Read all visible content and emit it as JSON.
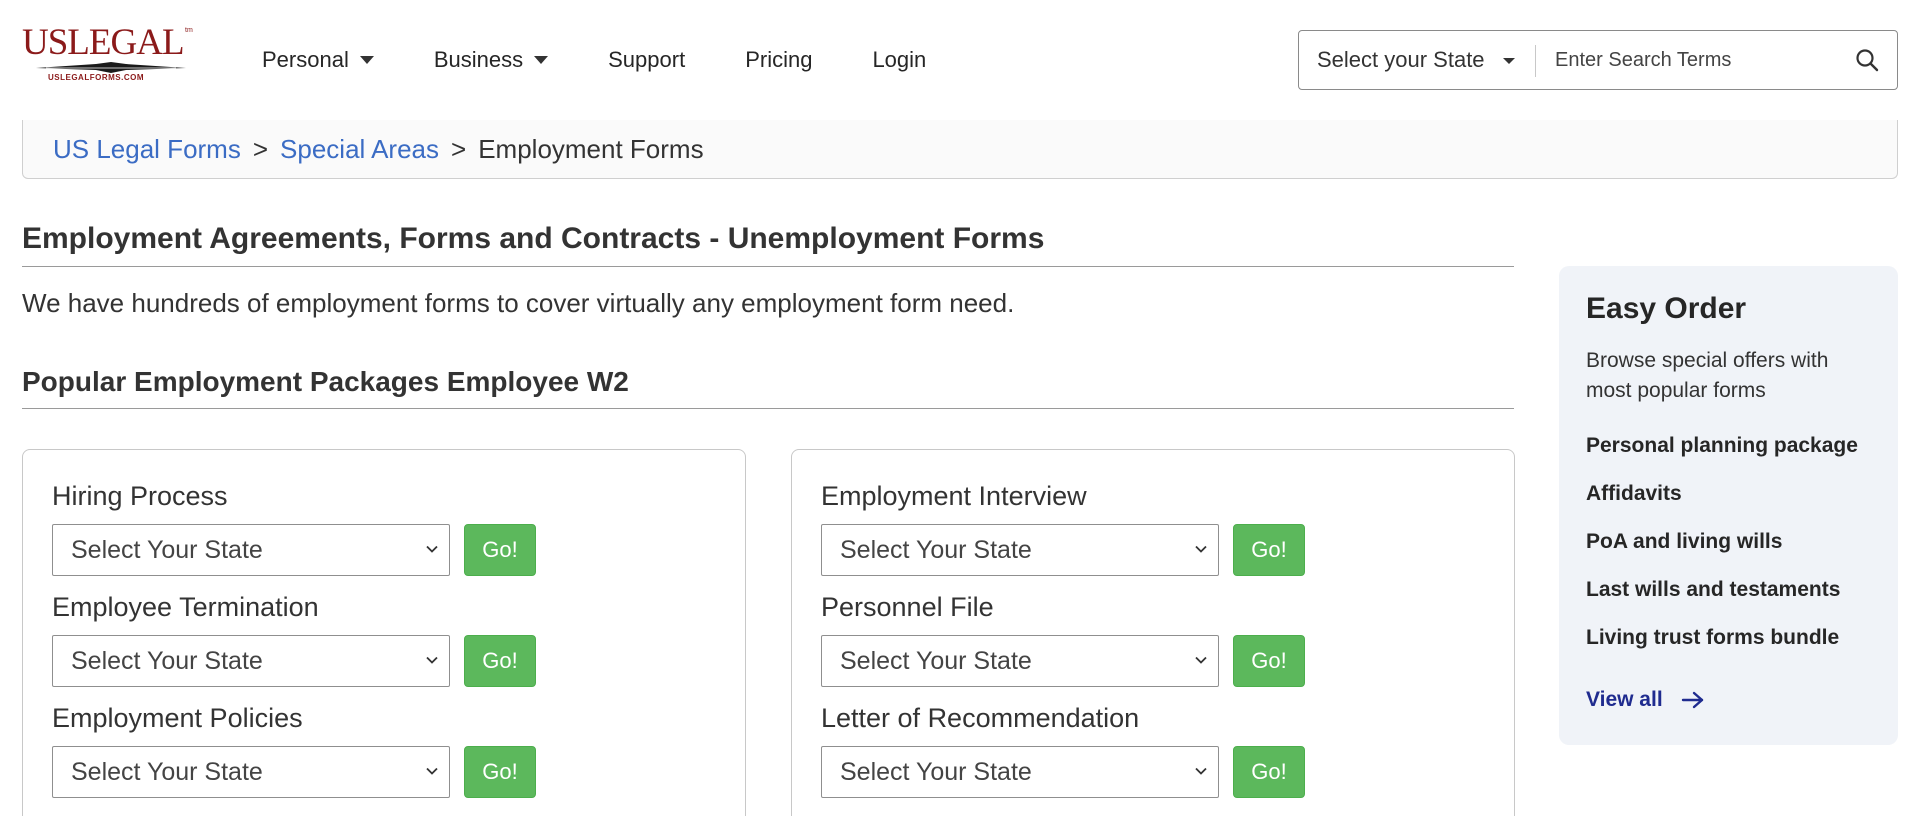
{
  "logo": {
    "brand": "USLEGAL",
    "tm": "tm",
    "domain": "USLEGALFORMS.COM",
    "color": "#8b1a1a"
  },
  "nav": {
    "items": [
      {
        "label": "Personal",
        "dropdown": true
      },
      {
        "label": "Business",
        "dropdown": true
      },
      {
        "label": "Support",
        "dropdown": false
      },
      {
        "label": "Pricing",
        "dropdown": false
      },
      {
        "label": "Login",
        "dropdown": false
      }
    ]
  },
  "search": {
    "state_label": "Select your State",
    "placeholder": "Enter Search Terms",
    "icon": "search-icon"
  },
  "breadcrumb": {
    "items": [
      "US Legal Forms",
      "Special Areas"
    ],
    "current": "Employment Forms",
    "separator": ">",
    "link_color": "#3b6cc4"
  },
  "main": {
    "title": "Employment Agreements, Forms and Contracts - Unemployment Forms",
    "intro": "We have hundreds of employment forms to cover virtually any employment form need.",
    "section_title": "Popular Employment Packages Employee W2",
    "select_placeholder": "Select Your State",
    "go_label": "Go!",
    "go_color": "#5cb85c",
    "left_forms": [
      "Hiring Process",
      "Employee Termination",
      "Employment Policies"
    ],
    "right_forms": [
      "Employment Interview",
      "Personnel File",
      "Letter of Recommendation"
    ]
  },
  "easy_order": {
    "title": "Easy Order",
    "description": "Browse special offers with most popular forms",
    "items": [
      "Personal planning package",
      "Affidavits",
      "PoA and living wills",
      "Last wills and testaments",
      "Living trust forms bundle"
    ],
    "view_all": "View all",
    "view_all_icon": "arrow-right-icon",
    "bg_color": "#f0f3f8"
  }
}
